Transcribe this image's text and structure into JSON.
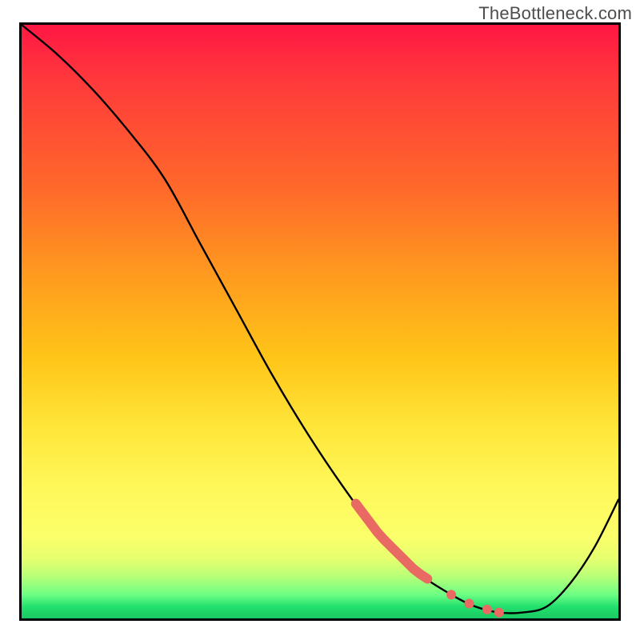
{
  "watermark": "TheBottleneck.com",
  "colors": {
    "highlight": "#e96a63",
    "line": "#000000"
  },
  "chart_data": {
    "type": "line",
    "title": "",
    "xlabel": "",
    "ylabel": "",
    "xlim": [
      0,
      100
    ],
    "ylim": [
      0,
      100
    ],
    "grid": false,
    "legend": false,
    "series": [
      {
        "name": "curve",
        "x": [
          0,
          6,
          12,
          18,
          24,
          30,
          36,
          42,
          48,
          54,
          60,
          66,
          72,
          76,
          80,
          84,
          88,
          92,
          96,
          100
        ],
        "y": [
          100,
          95,
          89,
          82,
          74,
          63,
          52,
          41,
          31,
          22,
          14,
          8,
          4,
          2,
          1,
          1,
          2,
          6,
          12,
          20
        ]
      }
    ],
    "highlight_segment": {
      "x_start": 56,
      "x_end": 68
    },
    "highlight_dots_x": [
      72,
      75,
      78,
      80
    ]
  }
}
